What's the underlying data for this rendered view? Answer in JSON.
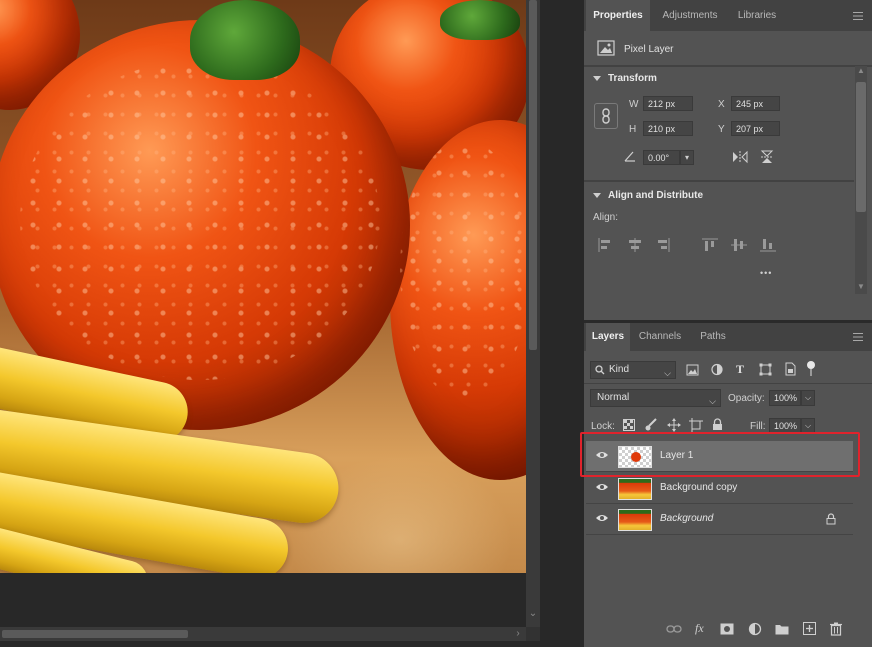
{
  "properties_panel": {
    "tabs": [
      {
        "label": "Properties",
        "active": true
      },
      {
        "label": "Adjustments",
        "active": false
      },
      {
        "label": "Libraries",
        "active": false
      }
    ],
    "layer_type": "Pixel Layer",
    "transform": {
      "title": "Transform",
      "w_label": "W",
      "w_value": "212 px",
      "h_label": "H",
      "h_value": "210 px",
      "x_label": "X",
      "x_value": "245 px",
      "y_label": "Y",
      "y_value": "207 px",
      "angle_value": "0.00°"
    },
    "align": {
      "title": "Align and Distribute",
      "align_label": "Align:",
      "more": "•••"
    }
  },
  "layers_panel": {
    "tabs": [
      {
        "label": "Layers",
        "active": true
      },
      {
        "label": "Channels",
        "active": false
      },
      {
        "label": "Paths",
        "active": false
      }
    ],
    "filter_kind": "Kind",
    "blend_mode": "Normal",
    "opacity_label": "Opacity:",
    "opacity_value": "100%",
    "lock_label": "Lock:",
    "fill_label": "Fill:",
    "fill_value": "100%",
    "layers": [
      {
        "name": "Layer 1",
        "selected": true,
        "visible": true,
        "thumb": "transparent-with-tomato",
        "locked": false
      },
      {
        "name": "Background copy",
        "selected": false,
        "visible": true,
        "thumb": "photo",
        "locked": false
      },
      {
        "name": "Background",
        "selected": false,
        "visible": true,
        "thumb": "photo",
        "locked": true,
        "italic": true
      }
    ],
    "footer_icons": [
      "link-icon",
      "fx-icon",
      "mask-icon",
      "adjustment-icon",
      "folder-icon",
      "new-layer-icon",
      "trash-icon"
    ]
  },
  "colors": {
    "panel_bg": "#535353",
    "tabbar_bg": "#424242",
    "selection_highlight": "#e0232c",
    "selected_row": "#6f6f6f"
  }
}
